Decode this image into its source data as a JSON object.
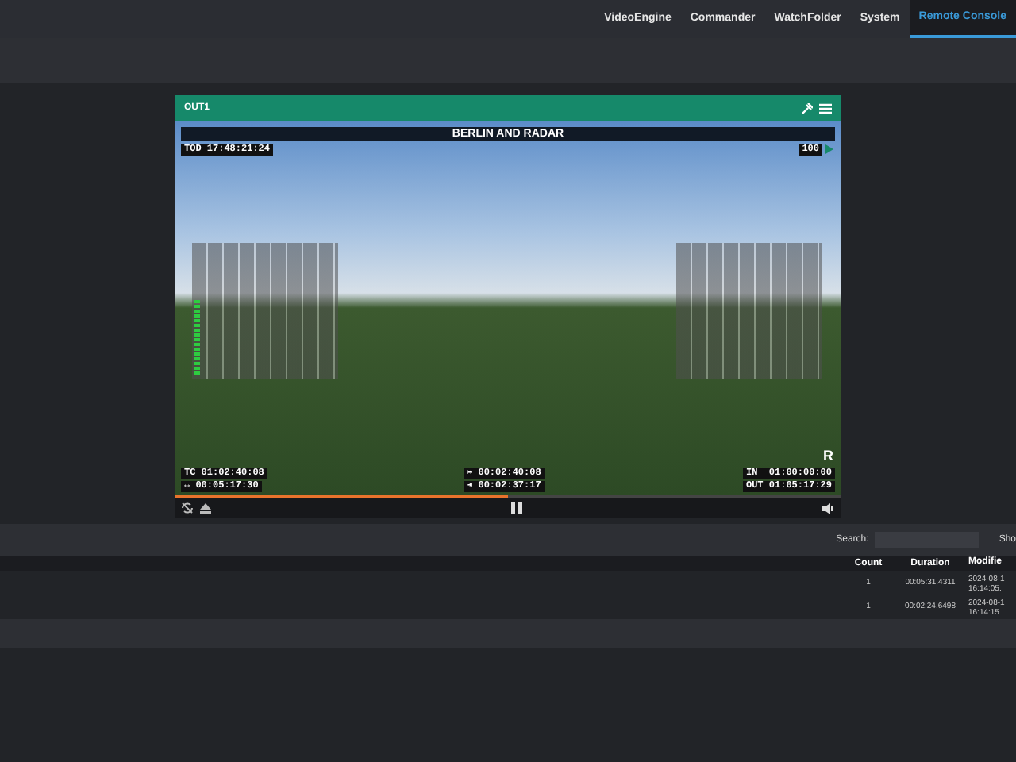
{
  "nav": [
    {
      "label": "VideoEngine",
      "selected": false
    },
    {
      "label": "Commander",
      "selected": false
    },
    {
      "label": "WatchFolder",
      "selected": false
    },
    {
      "label": "System",
      "selected": false
    },
    {
      "label": "Remote Console",
      "selected": true
    }
  ],
  "player": {
    "title": "OUT1",
    "clip_title": "BERLIN AND RADAR",
    "tod": "TOD 17:48:21:24",
    "volume": "100",
    "corner_mark": "R",
    "timecodes_left": [
      "TC 01:02:40:08",
      "↔ 00:05:17:30"
    ],
    "timecodes_center": [
      "↦ 00:02:40:08",
      "⇥ 00:02:37:17"
    ],
    "timecodes_right": [
      "IN  01:00:00:00",
      "OUT 01:05:17:29"
    ],
    "progress": {
      "level": 0.5
    }
  },
  "search": {
    "label": "Search:",
    "show_label": "Sho"
  },
  "table": {
    "columns": [
      "Count",
      "Duration",
      "Modifie"
    ],
    "rows": [
      [
        "1",
        "00:05:31.4311",
        "2024-08-1\n16:14:05."
      ],
      [
        "1",
        "00:02:24.6498",
        "2024-08-1\n16:14:15."
      ]
    ]
  }
}
